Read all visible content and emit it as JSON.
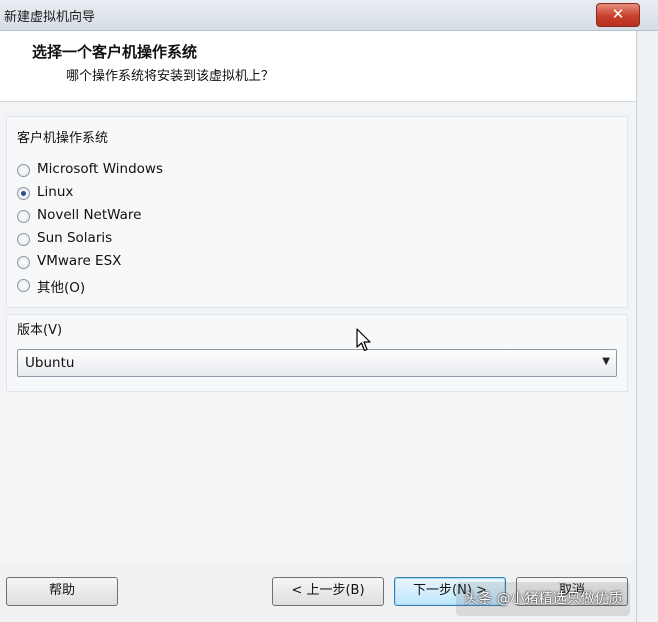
{
  "window": {
    "title": "新建虚拟机向导",
    "close_glyph": "✕"
  },
  "header": {
    "title": "选择一个客户机操作系统",
    "subtitle": "哪个操作系统将安装到该虚拟机上？"
  },
  "guest_os": {
    "label": "客户机操作系统",
    "options": [
      {
        "label": "Microsoft Windows",
        "checked": false
      },
      {
        "label": "Linux",
        "checked": true
      },
      {
        "label": "Novell NetWare",
        "checked": false
      },
      {
        "label": "Sun Solaris",
        "checked": false
      },
      {
        "label": "VMware ESX",
        "checked": false
      },
      {
        "label": "其他(O)",
        "checked": false
      }
    ]
  },
  "version": {
    "label": "版本(V)",
    "selected": "Ubuntu"
  },
  "buttons": {
    "help": "帮助",
    "back": "< 上一步(B)",
    "next": "下一步(N) >",
    "cancel": "取消"
  },
  "watermark": "头条 @小猪精选只做优质",
  "colors": {
    "close_red": "#c9402c",
    "primary_button": "#bee6fd"
  }
}
